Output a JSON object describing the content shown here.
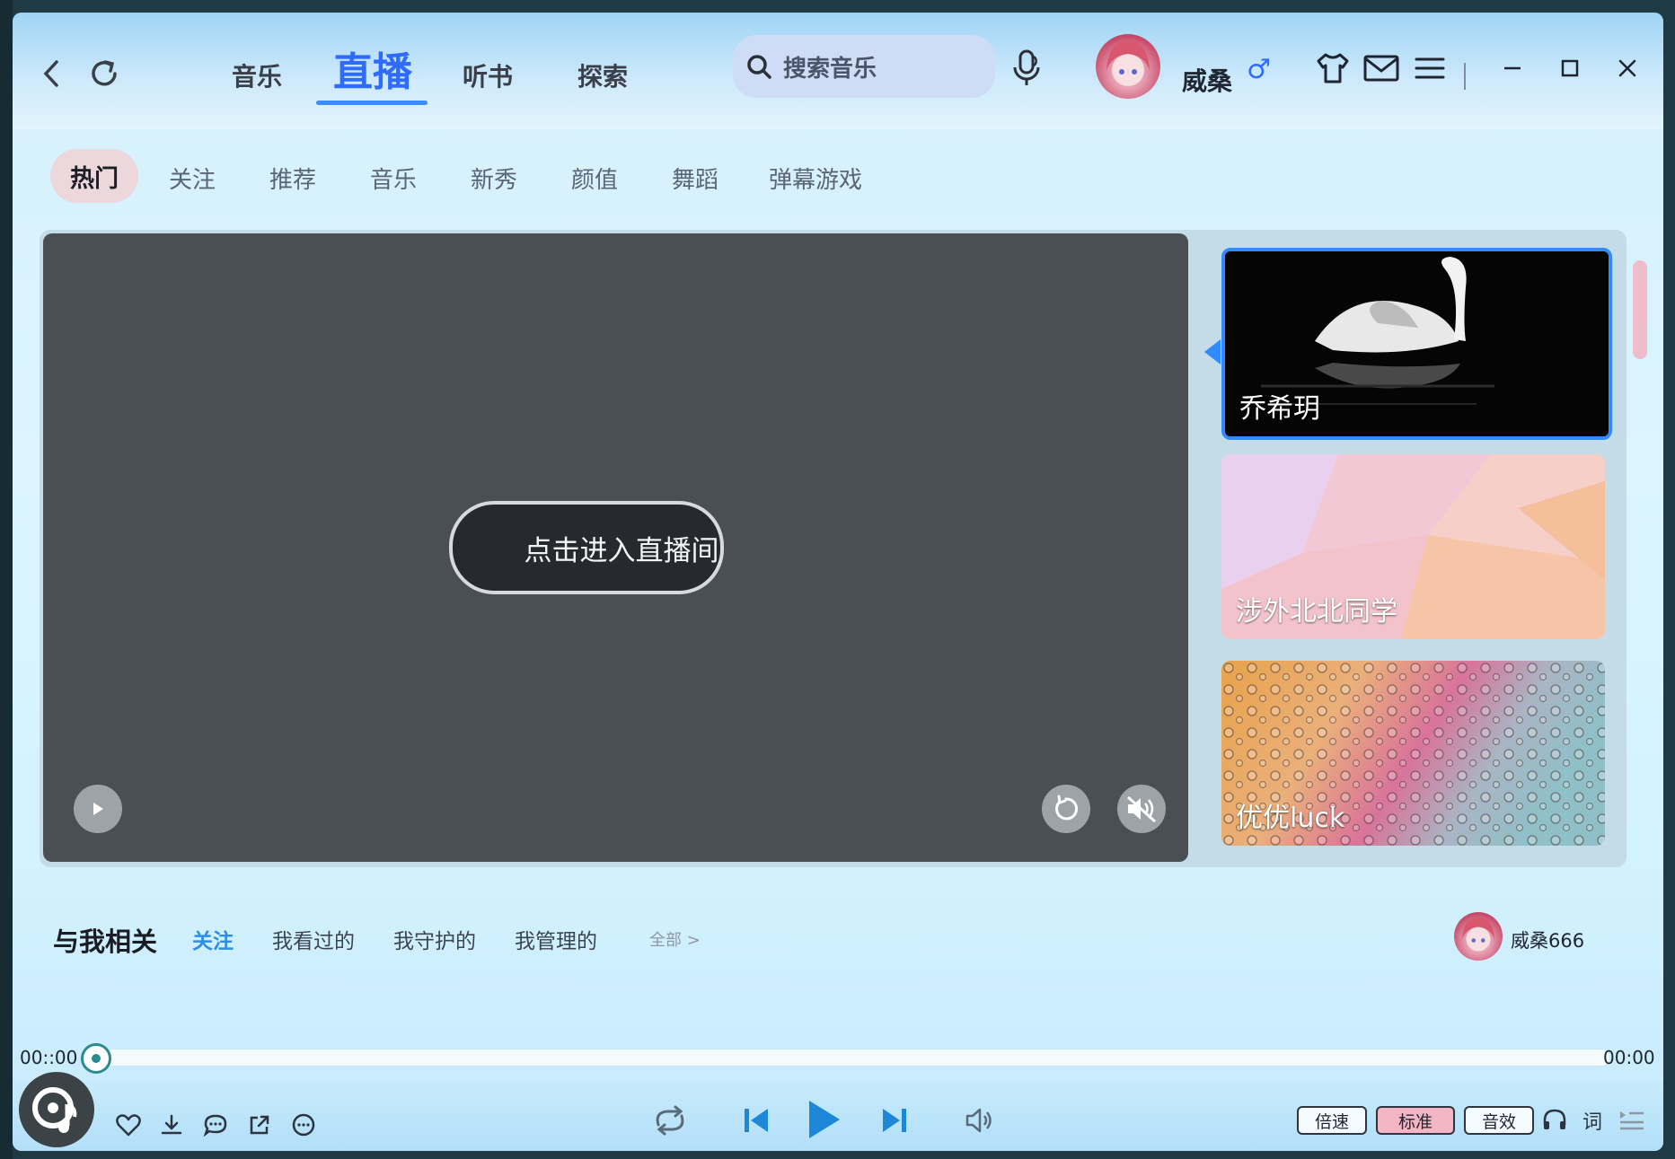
{
  "header": {
    "tabs": [
      {
        "label": "音乐"
      },
      {
        "label": "直播"
      },
      {
        "label": "听书"
      },
      {
        "label": "探索"
      }
    ],
    "active_tab": "直播",
    "search": {
      "placeholder": "搜索音乐"
    },
    "user": {
      "name": "威桑",
      "gender_symbol": "♂"
    }
  },
  "categories": {
    "active": "热门",
    "items": [
      "热门",
      "关注",
      "推荐",
      "音乐",
      "新秀",
      "颜值",
      "舞蹈",
      "弹幕游戏"
    ]
  },
  "live": {
    "enter_label": "点击进入直播间",
    "cards": [
      {
        "name": "乔希玥",
        "selected": true
      },
      {
        "name": "涉外北北同学",
        "selected": false
      },
      {
        "name": "优优luck",
        "selected": false
      }
    ]
  },
  "related": {
    "title": "与我相关",
    "tabs": [
      "关注",
      "我看过的",
      "我守护的",
      "我管理的"
    ],
    "active": "关注",
    "all_label": "全部 >",
    "user_name": "威桑666"
  },
  "player": {
    "current_time": "00::00",
    "total_time": "00:00",
    "progress": 0,
    "speed_label": "倍速",
    "quality_label": "标准",
    "effect_label": "音效",
    "lyric_label": "词"
  },
  "colors": {
    "accent": "#2f6bff",
    "active_tab_underline": "#3b8cff",
    "related_active": "#2d8ee8",
    "quality_pill": "#f4b6c4",
    "play_button": "#1e88d8"
  }
}
